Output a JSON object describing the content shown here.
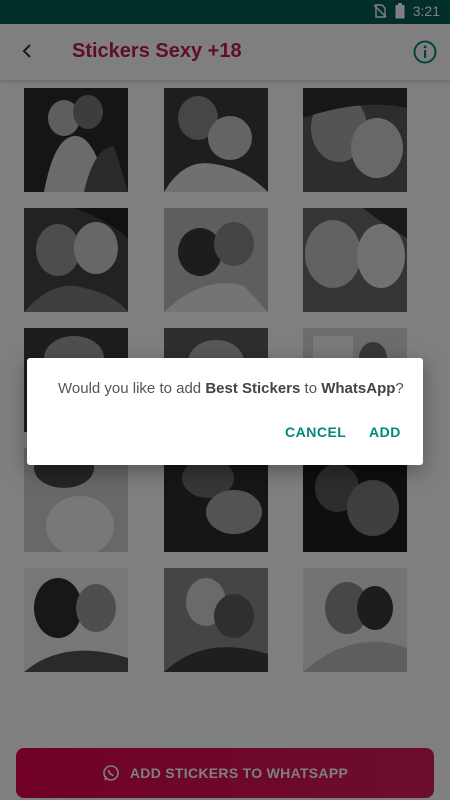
{
  "status_bar": {
    "time": "3:21"
  },
  "app_bar": {
    "title": "Stickers Sexy +18"
  },
  "stickers": [
    {
      "name": "sticker-1"
    },
    {
      "name": "sticker-2"
    },
    {
      "name": "sticker-3"
    },
    {
      "name": "sticker-4"
    },
    {
      "name": "sticker-5"
    },
    {
      "name": "sticker-6"
    },
    {
      "name": "sticker-7"
    },
    {
      "name": "sticker-8"
    },
    {
      "name": "sticker-9"
    },
    {
      "name": "sticker-10"
    },
    {
      "name": "sticker-11"
    },
    {
      "name": "sticker-12"
    },
    {
      "name": "sticker-13"
    },
    {
      "name": "sticker-14"
    },
    {
      "name": "sticker-15"
    }
  ],
  "bottom_button": {
    "label": "ADD STICKERS TO WHATSAPP",
    "icon": "whatsapp-icon"
  },
  "dialog": {
    "message_prefix": "Would you like to add ",
    "pack_name": "Best Stickers",
    "message_middle": " to ",
    "app_name": "WhatsApp",
    "message_suffix": "?",
    "cancel_label": "CANCEL",
    "ok_label": "ADD"
  },
  "colors": {
    "status_bar": "#075e54",
    "title": "#c2185b",
    "accent": "#00897b",
    "button": "#e0004d"
  }
}
